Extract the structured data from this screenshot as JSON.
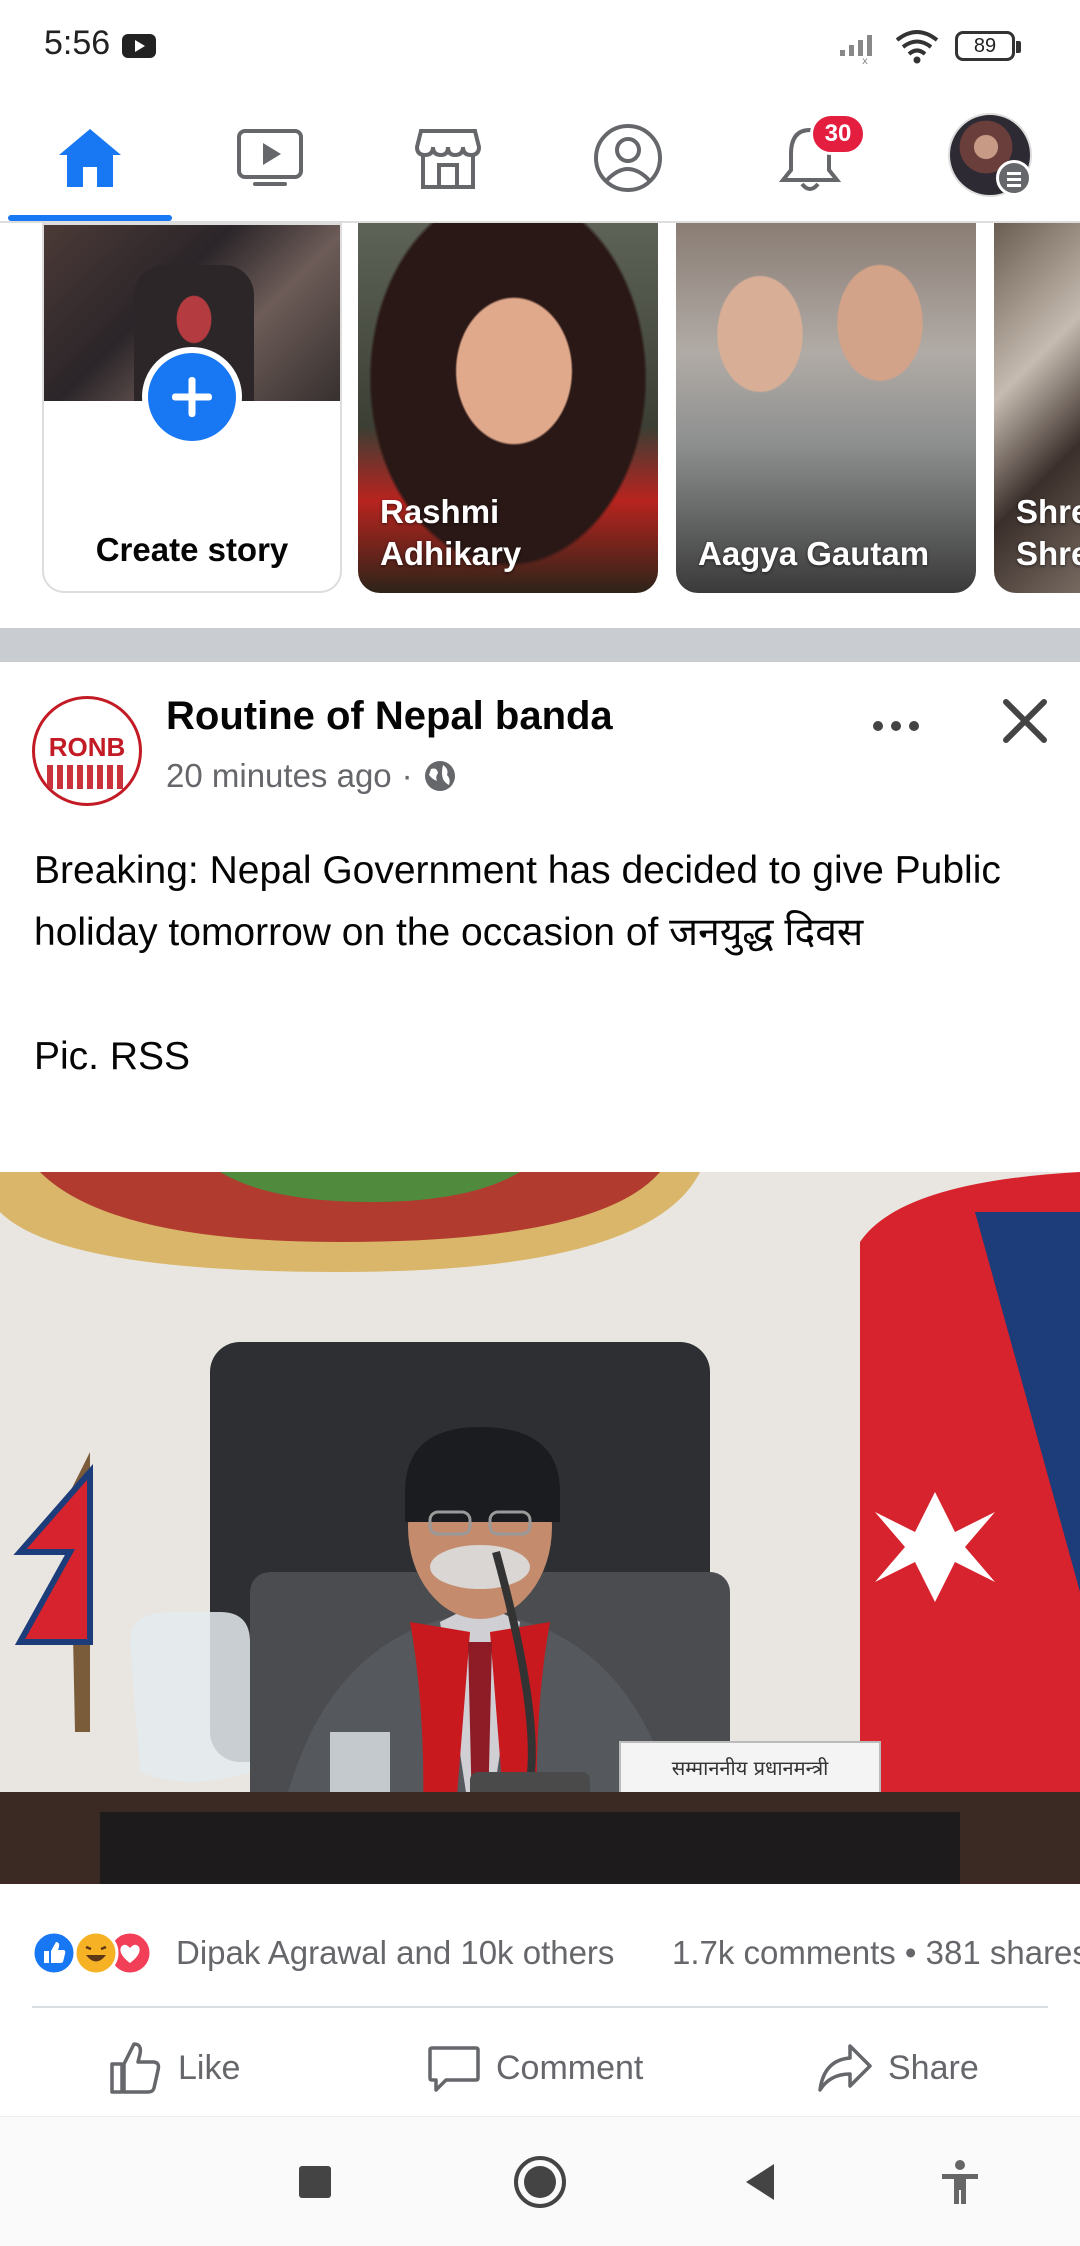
{
  "status_bar": {
    "time": "5:56",
    "battery": "89"
  },
  "tabs": [
    {
      "name": "home",
      "active": true
    },
    {
      "name": "watch",
      "active": false
    },
    {
      "name": "marketplace",
      "active": false
    },
    {
      "name": "profile",
      "active": false
    },
    {
      "name": "notifications",
      "active": false,
      "badge": "30"
    },
    {
      "name": "menu",
      "active": false
    }
  ],
  "stories": {
    "create_label": "Create story",
    "items": [
      {
        "name": "Rashmi Adhikary"
      },
      {
        "name": "Aagya Gautam"
      },
      {
        "name": "Shre Shre"
      }
    ]
  },
  "post": {
    "page_name": "Routine of Nepal banda",
    "page_avatar_text": "RONB",
    "time": "20 minutes ago",
    "separator": "·",
    "privacy": "public",
    "body": "Breaking: Nepal Government has decided to give Public holiday tomorrow on the occasion of जनयुद्ध दिवस\n\nPic. RSS",
    "photo_nameplate": "सम्माननीय प्रधानमन्त्री",
    "reactions_text": "Dipak Agrawal and 10k others",
    "counts_text": "1.7k comments • 381 shares",
    "actions": {
      "like": "Like",
      "comment": "Comment",
      "share": "Share"
    }
  },
  "colors": {
    "accent": "#1877f2",
    "badge": "#e41e3f",
    "ronb_red": "#c31b25",
    "muted": "#65676b"
  },
  "nav": [
    "square",
    "circle",
    "back",
    "accessibility"
  ]
}
